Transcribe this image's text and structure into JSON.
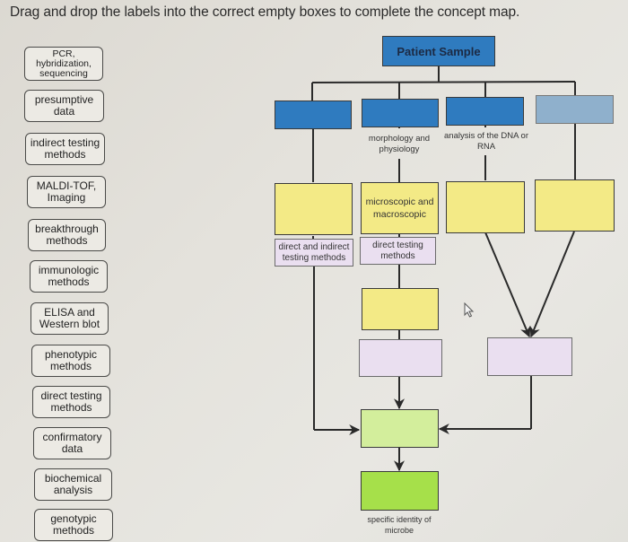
{
  "instruction": "Drag and drop the labels into the correct empty boxes to complete the concept map.",
  "label_bank": [
    {
      "text": "PCR, hybridization, sequencing"
    },
    {
      "text": "presumptive data"
    },
    {
      "text": "indirect testing methods"
    },
    {
      "text": "MALDI-TOF, Imaging"
    },
    {
      "text": "breakthrough methods"
    },
    {
      "text": "immunologic methods"
    },
    {
      "text": "ELISA and Western blot"
    },
    {
      "text": "phenotypic methods"
    },
    {
      "text": "direct testing methods"
    },
    {
      "text": "confirmatory data"
    },
    {
      "text": "biochemical analysis"
    },
    {
      "text": "genotypic methods"
    }
  ],
  "concept_map": {
    "root": "Patient Sample",
    "level1_boxes": [
      "",
      "",
      "",
      ""
    ],
    "level1_captions": [
      "",
      "morphology and physiology",
      "analysis of the DNA or RNA",
      ""
    ],
    "level2_boxes": [
      "",
      "microscopic and macroscopic",
      "",
      ""
    ],
    "level3_boxes": [
      "direct and indirect testing methods",
      "direct testing methods"
    ],
    "middle_yellow_box": "",
    "middle_lavender_box": "",
    "right_lavender_box": "",
    "light_green_box": "",
    "green_box": "",
    "final_caption": "specific identity of microbe"
  },
  "colors": {
    "dark_blue": "#2f7bbf",
    "light_blue": "#8fb0cc",
    "yellow": "#f3ea86",
    "lavender": "#eadff0",
    "light_green": "#d3ee9c",
    "green": "#a6e04a"
  }
}
